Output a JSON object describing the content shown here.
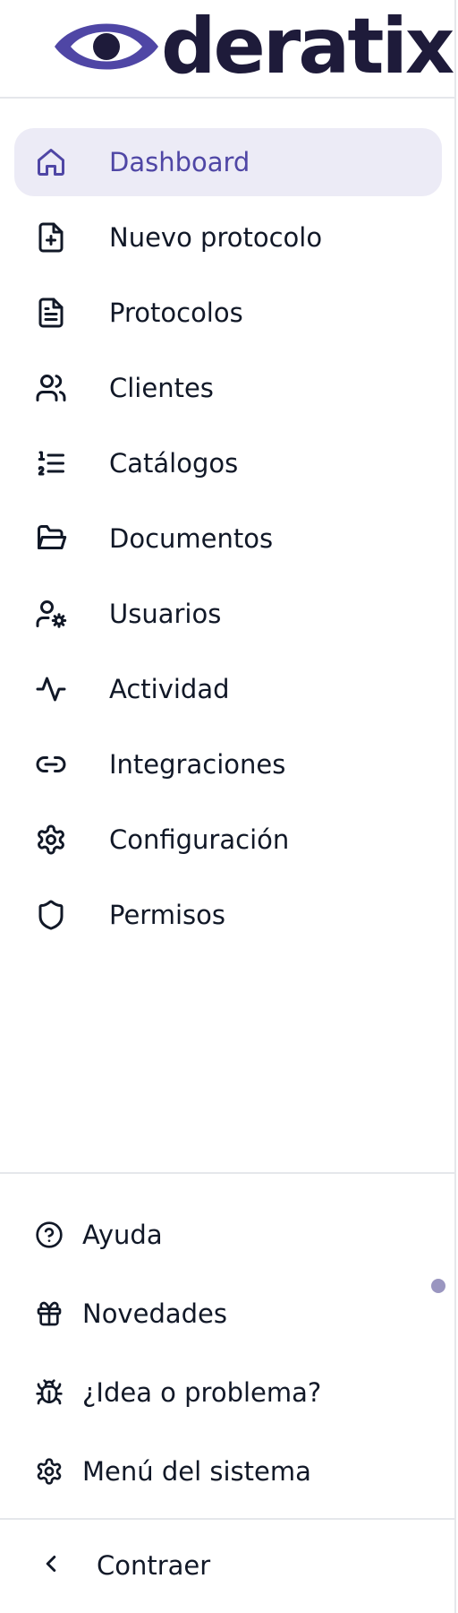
{
  "brand": {
    "logo_text": "deratix",
    "accent_color": "#4f46a5",
    "logo_dark_color": "#1e1b3a"
  },
  "nav": {
    "items": [
      {
        "label": "Dashboard",
        "icon": "home-icon",
        "active": true
      },
      {
        "label": "Nuevo protocolo",
        "icon": "file-plus-icon"
      },
      {
        "label": "Protocolos",
        "icon": "file-text-icon"
      },
      {
        "label": "Clientes",
        "icon": "users-icon"
      },
      {
        "label": "Catálogos",
        "icon": "list-ordered-icon"
      },
      {
        "label": "Documentos",
        "icon": "folder-open-icon"
      },
      {
        "label": "Usuarios",
        "icon": "user-cog-icon"
      },
      {
        "label": "Actividad",
        "icon": "activity-icon"
      },
      {
        "label": "Integraciones",
        "icon": "link-icon"
      },
      {
        "label": "Configuración",
        "icon": "settings-icon"
      },
      {
        "label": "Permisos",
        "icon": "shield-icon"
      }
    ]
  },
  "footer": {
    "items": [
      {
        "label": "Ayuda",
        "icon": "help-circle-icon"
      },
      {
        "label": "Novedades",
        "icon": "gift-icon",
        "has_unread_dot": true
      },
      {
        "label": "¿Idea o problema?",
        "icon": "bug-icon"
      },
      {
        "label": "Menú del sistema",
        "icon": "settings-icon"
      }
    ],
    "collapse_label": "Contraer",
    "collapse_icon": "chevron-left-icon",
    "unread_dot_color": "#9a96c0"
  }
}
